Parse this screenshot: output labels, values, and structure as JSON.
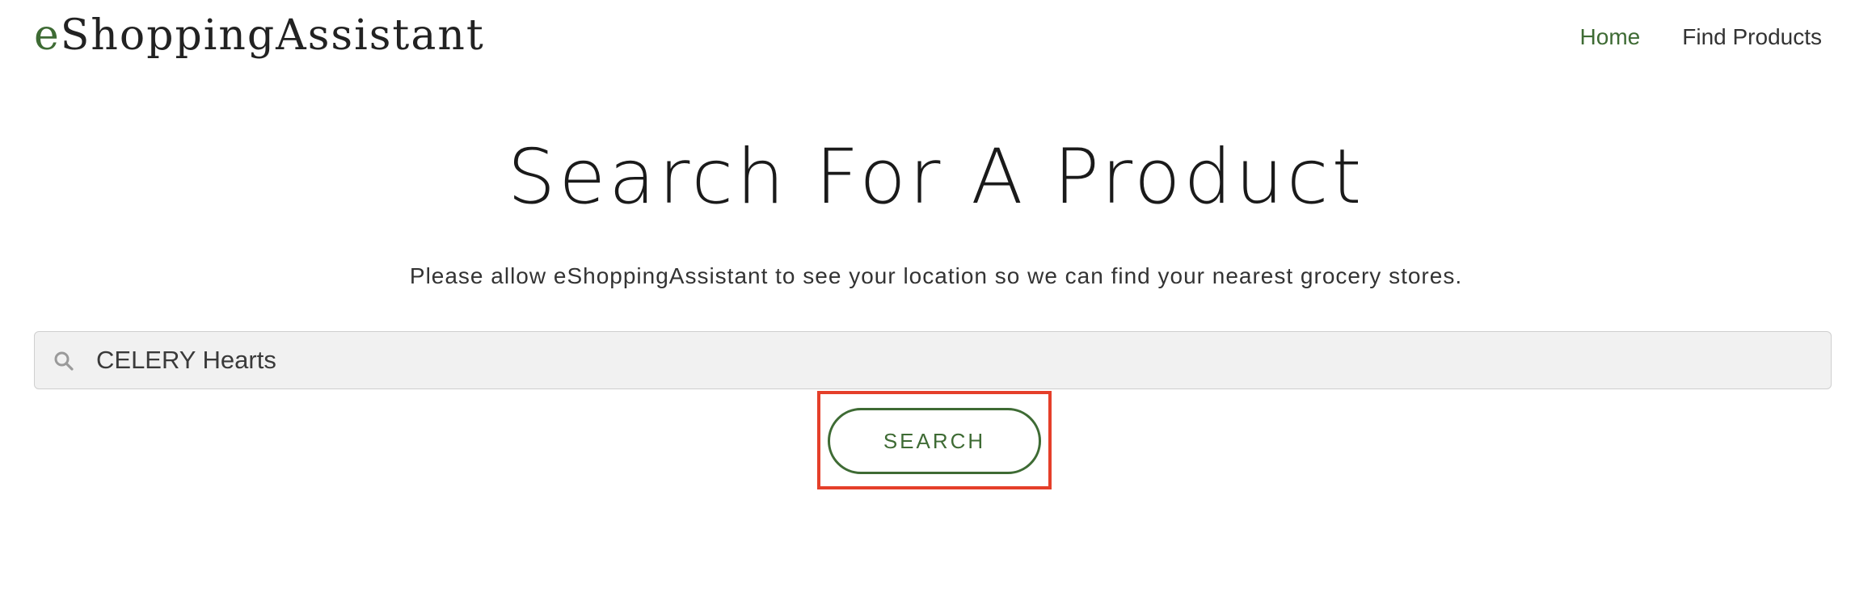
{
  "header": {
    "logo": {
      "first_letter": "e",
      "rest": "ShoppingAssistant"
    },
    "nav": [
      {
        "label": "Home",
        "active": true
      },
      {
        "label": "Find Products",
        "active": false
      }
    ]
  },
  "main": {
    "title": "Search For A Product",
    "subtitle": "Please allow eShoppingAssistant to see your location so we can find your nearest grocery stores.",
    "search": {
      "value": "CELERY Hearts",
      "icon": "search-icon"
    },
    "search_button_label": "SEARCH"
  },
  "colors": {
    "accent": "#3e6b34",
    "highlight": "#e53f2a",
    "input_bg": "#f1f1f1"
  }
}
